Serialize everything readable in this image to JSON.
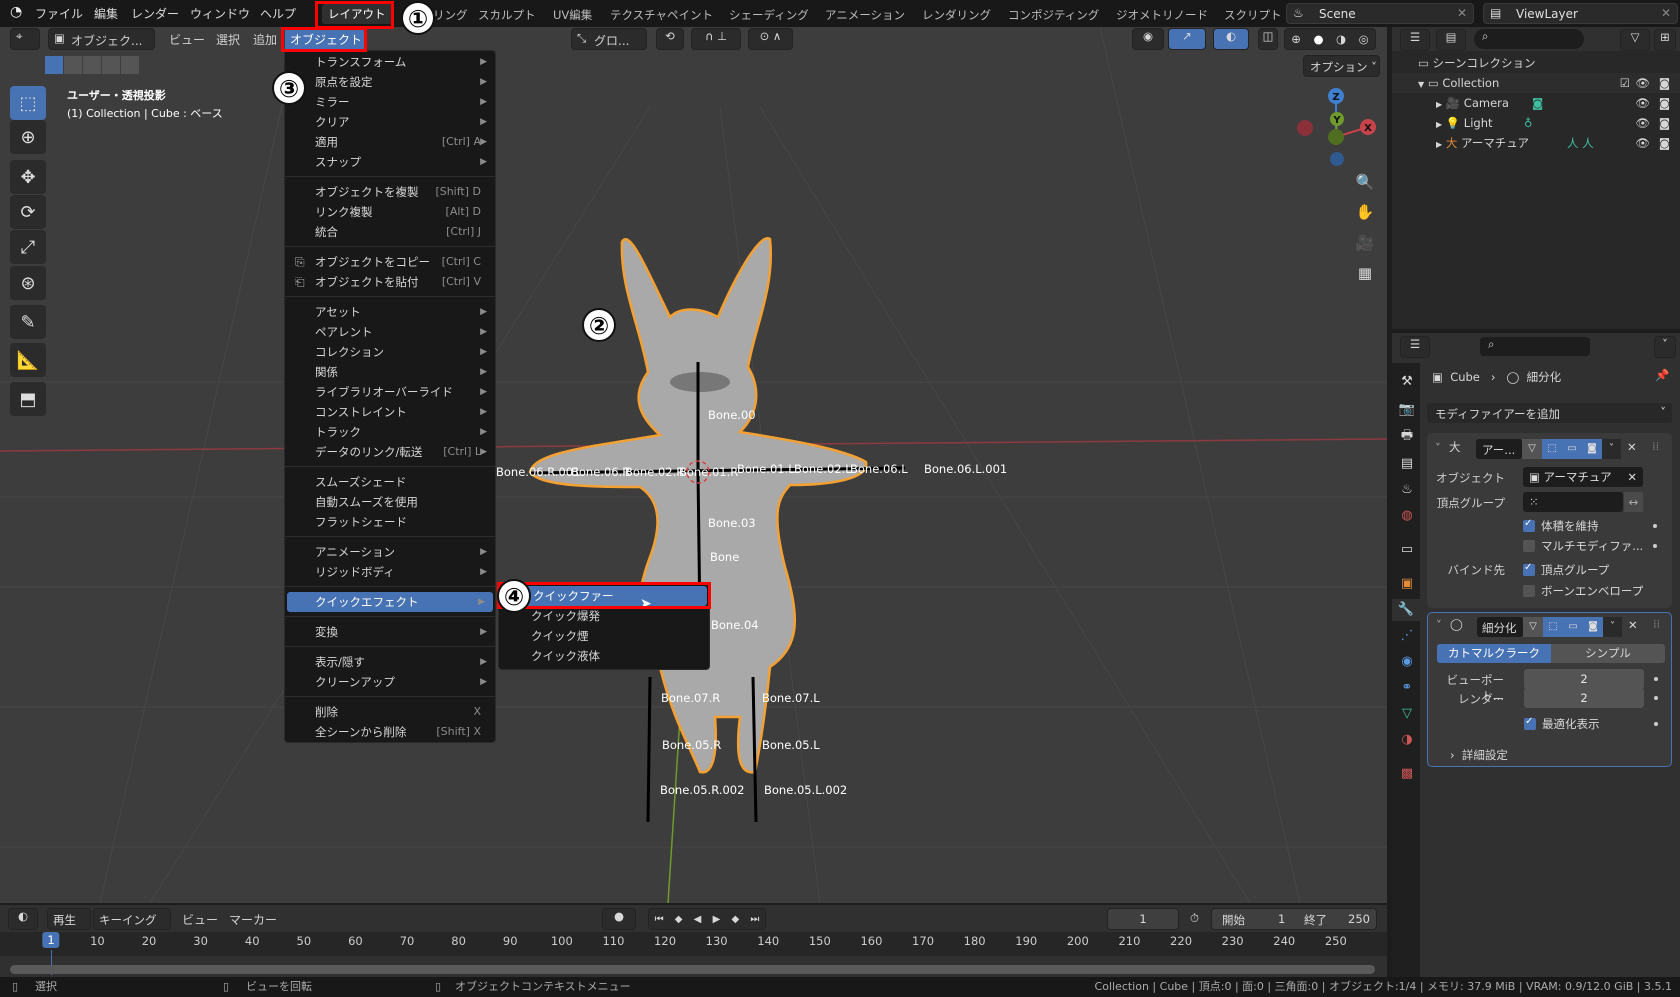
{
  "colors": {
    "accent": "#4772b3",
    "annotation_box": "#ff0000",
    "selection_outline": "#f4a032",
    "x_axis": "#c8424c",
    "y_axis": "#6f9a2c",
    "z_axis": "#3f7fd0"
  },
  "topbar": {
    "menus": [
      "ファイル",
      "編集",
      "レンダー",
      "ウィンドウ",
      "ヘルプ"
    ],
    "workspaces": [
      "レイアウト",
      "モデリング",
      "スカルプト",
      "UV編集",
      "テクスチャペイント",
      "シェーディング",
      "アニメーション",
      "レンダリング",
      "コンポジティング",
      "ジオメトリノード",
      "スクリプト"
    ],
    "scene": "Scene",
    "view_layer": "ViewLayer"
  },
  "annotations": [
    "①",
    "②",
    "③",
    "④"
  ],
  "viewport": {
    "header": {
      "mode": "オブジェク...",
      "view": "ビュー",
      "select": "選択",
      "add": "追加",
      "object": "オブジェクト",
      "orientation": "グロ...",
      "options": "オプション"
    },
    "overlay": {
      "view_name": "ユーザー・透視投影",
      "object_info": "(1) Collection | Cube : ベース"
    },
    "gizmo": {
      "x": "X",
      "y": "Y",
      "z": "Z"
    },
    "bones": [
      "Bone.00",
      "Bone.06.R.001",
      "Bone.06.R",
      "Bone.02.R",
      "Bone.01.R",
      "Bone.01.L",
      "Bone.02.L",
      "Bone.06.L",
      "Bone.06.L.001",
      "Bone.03",
      "Bone",
      "Bone.04",
      "Bone.07.R",
      "Bone.07.L",
      "Bone.05.R",
      "Bone.05.L",
      "Bone.05.R.002",
      "Bone.05.L.002"
    ]
  },
  "object_menu": {
    "items": [
      {
        "label": "トランスフォーム",
        "sub": true
      },
      {
        "label": "原点を設定",
        "sub": true
      },
      {
        "label": "ミラー",
        "sub": true
      },
      {
        "label": "クリア",
        "sub": true
      },
      {
        "label": "適用",
        "shortcut": "[Ctrl] A",
        "sub": true
      },
      {
        "label": "スナップ",
        "sub": true
      },
      {
        "sep": true
      },
      {
        "label": "オブジェクトを複製",
        "shortcut": "[Shift] D"
      },
      {
        "label": "リンク複製",
        "shortcut": "[Alt] D"
      },
      {
        "label": "統合",
        "shortcut": "[Ctrl] J"
      },
      {
        "sep": true
      },
      {
        "label": "オブジェクトをコピー",
        "shortcut": "[Ctrl] C",
        "icon": "copy-icon"
      },
      {
        "label": "オブジェクトを貼付",
        "shortcut": "[Ctrl] V",
        "icon": "paste-icon"
      },
      {
        "sep": true
      },
      {
        "label": "アセット",
        "sub": true
      },
      {
        "label": "ペアレント",
        "sub": true
      },
      {
        "label": "コレクション",
        "sub": true
      },
      {
        "label": "関係",
        "sub": true
      },
      {
        "label": "ライブラリオーバーライド",
        "sub": true
      },
      {
        "label": "コンストレイント",
        "sub": true
      },
      {
        "label": "トラック",
        "sub": true
      },
      {
        "label": "データのリンク/転送",
        "shortcut": "[Ctrl] L",
        "sub": true
      },
      {
        "sep": true
      },
      {
        "label": "スムーズシェード"
      },
      {
        "label": "自動スムーズを使用"
      },
      {
        "label": "フラットシェード"
      },
      {
        "sep": true
      },
      {
        "label": "アニメーション",
        "sub": true
      },
      {
        "label": "リジッドボディ",
        "sub": true
      },
      {
        "sep": true
      },
      {
        "label": "クイックエフェクト",
        "sub": true,
        "highlighted": true
      },
      {
        "sep": true
      },
      {
        "label": "変換",
        "sub": true
      },
      {
        "sep": true
      },
      {
        "label": "表示/隠す",
        "sub": true
      },
      {
        "label": "クリーンアップ",
        "sub": true
      },
      {
        "sep": true
      },
      {
        "label": "削除",
        "shortcut": "X"
      },
      {
        "label": "全シーンから削除",
        "shortcut": "[Shift] X"
      }
    ]
  },
  "quick_effects": {
    "items": [
      {
        "label": "クイックファー",
        "highlighted": true
      },
      {
        "label": "クイック爆発"
      },
      {
        "label": "クイック煙"
      },
      {
        "label": "クイック液体"
      }
    ]
  },
  "outliner": {
    "title": "シーンコレクション",
    "collection": "Collection",
    "items": [
      "Camera",
      "Light",
      "アーマチュア"
    ]
  },
  "properties": {
    "breadcrumb": {
      "object": "Cube",
      "modifier": "細分化"
    },
    "add_modifier": "モディファイアーを追加",
    "armature": {
      "name": "アー...",
      "object_label": "オブジェクト",
      "object_value": "アーマチュア",
      "vertex_group_label": "頂点グループ",
      "preserve_volume": {
        "label": "体積を維持",
        "checked": true
      },
      "multi_modifier": {
        "label": "マルチモディファ...",
        "checked": false
      },
      "bind_label": "バインド先",
      "bind_vertex_groups": {
        "label": "頂点グループ",
        "checked": true
      },
      "bind_bone_envelopes": {
        "label": "ボーンエンベロープ",
        "checked": false
      }
    },
    "subdivision": {
      "name": "細分化",
      "tabs": [
        "カトマルクラーク",
        "シンプル"
      ],
      "active_tab": "カトマルクラーク",
      "viewport_label": "ビューポート...",
      "viewport_value": "2",
      "render_label": "レンダー",
      "render_value": "2",
      "optimal": {
        "label": "最適化表示",
        "checked": true
      },
      "advanced": "詳細設定"
    }
  },
  "timeline": {
    "header": {
      "playback": "再生",
      "keying": "キーイング",
      "view": "ビュー",
      "marker": "マーカー"
    },
    "current_frame": "1",
    "start_label": "開始",
    "start": "1",
    "end_label": "終了",
    "end": "250",
    "ticks": [
      1,
      10,
      20,
      30,
      40,
      50,
      60,
      70,
      80,
      90,
      100,
      110,
      120,
      130,
      140,
      150,
      160,
      170,
      180,
      190,
      200,
      210,
      220,
      230,
      240,
      250
    ]
  },
  "statusbar": {
    "select": "選択",
    "rotate": "ビューを回転",
    "context_menu": "オブジェクトコンテキストメニュー",
    "stats": "Collection | Cube | 頂点:0 | 面:0 | 三角面:0 | オブジェクト:1/4 | メモリ: 37.9 MiB | VRAM: 0.9/12.0 GiB | 3.5.1"
  }
}
